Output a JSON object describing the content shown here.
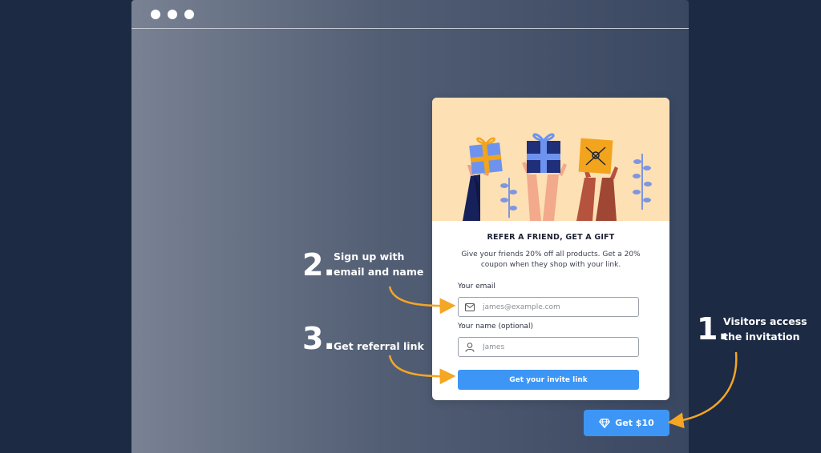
{
  "widget": {
    "title": "REFER A FRIEND, GET A GIFT",
    "description": "Give your friends 20% off all products. Get a 20% coupon when they shop with your link.",
    "email_label": "Your email",
    "email_placeholder": "james@example.com",
    "name_label": "Your name (optional)",
    "name_placeholder": "James",
    "submit_label": "Get your invite link"
  },
  "launcher": {
    "label": "Get $10",
    "icon": "diamond-icon"
  },
  "steps": [
    {
      "number": "1.",
      "text_line1": "Visitors access",
      "text_line2": "the invitation"
    },
    {
      "number": "2.",
      "text_line1": "Sign up with",
      "text_line2": "email and name"
    },
    {
      "number": "3.",
      "text_line1": "Get referral link"
    }
  ],
  "colors": {
    "page_background": "#1c2a44",
    "accent_blue": "#3d96f5",
    "arrow_orange": "#f5a623",
    "hero_background": "#fde0b4"
  }
}
